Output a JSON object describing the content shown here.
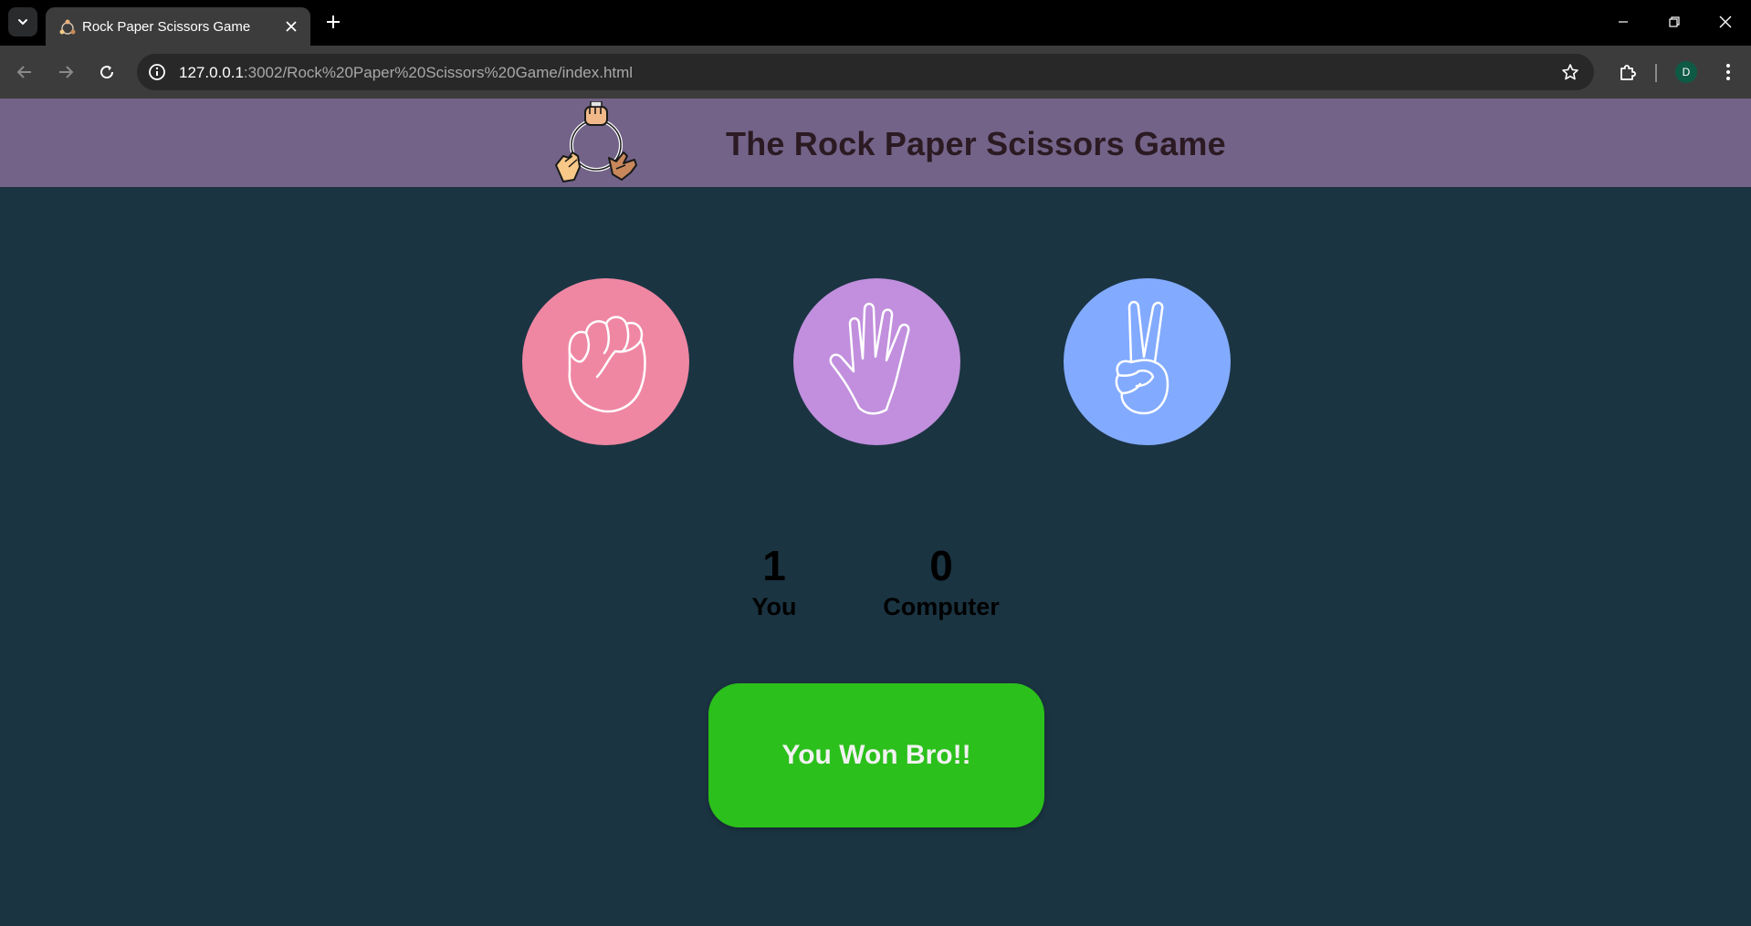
{
  "browser": {
    "tab_title": "Rock Paper Scissors Game",
    "url_host": "127.0.0.1",
    "url_rest": ":3002/Rock%20Paper%20Scissors%20Game/index.html",
    "profile_initial": "D"
  },
  "header": {
    "title": "The Rock Paper Scissors Game"
  },
  "choices": [
    {
      "id": "rock",
      "icon": "fist-icon",
      "color": "#ef87a3"
    },
    {
      "id": "paper",
      "icon": "open-hand-icon",
      "color": "#c18fdd"
    },
    {
      "id": "scissors",
      "icon": "peace-sign-icon",
      "color": "#82abff"
    }
  ],
  "scoreboard": {
    "user_score": "1",
    "user_label": "You",
    "computer_score": "0",
    "computer_label": "Computer"
  },
  "message": {
    "text": "You Won Bro!!",
    "color": "#2bc01b"
  }
}
